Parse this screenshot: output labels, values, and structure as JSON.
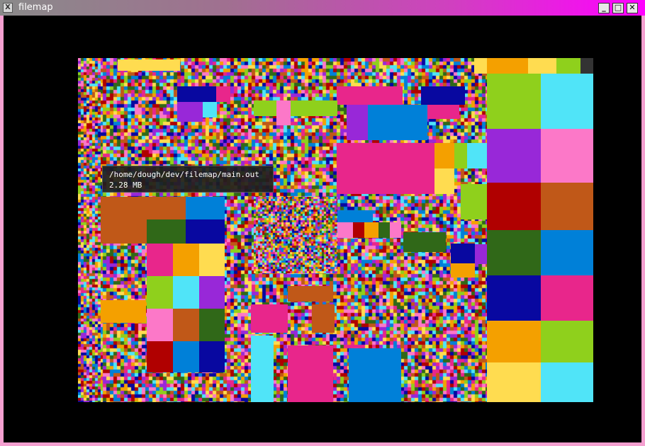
{
  "window": {
    "title": "filemap",
    "app_icon": "x-icon",
    "controls": {
      "minimize": "minimize-icon",
      "maximize": "maximize-icon",
      "close": "close-icon"
    }
  },
  "tooltip": {
    "path": "/home/dough/dev/filemap/main.out",
    "size": "2.28 MB"
  },
  "palette": [
    "#e8268b",
    "#0080d8",
    "#8fd01c",
    "#9828d8",
    "#fc78c8",
    "#f4a000",
    "#ffdc50",
    "#50e4f8",
    "#c05818",
    "#306818",
    "#0808a0",
    "#b00000"
  ]
}
